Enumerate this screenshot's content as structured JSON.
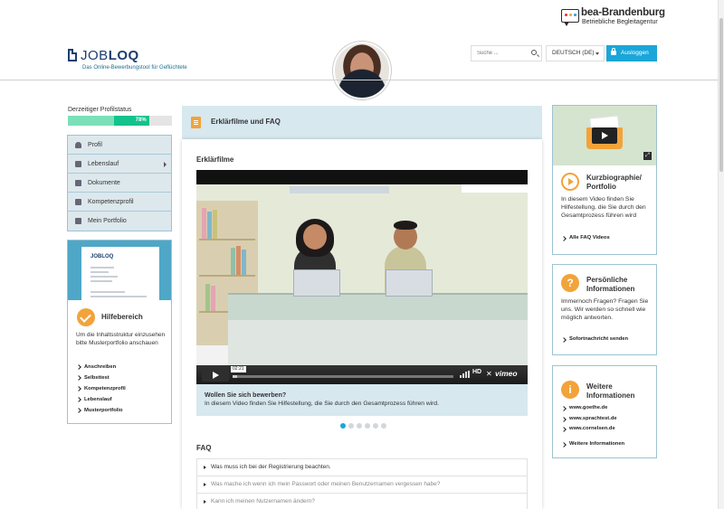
{
  "brand": {
    "partner_name": "bea-Brandenburg",
    "partner_subtitle": "Betriebliche Begleitagentur",
    "app_name_light": "JOB",
    "app_name_bold": "LOQ",
    "tagline": "Das Online-Bewerbungstool für Geflüchtete",
    "colors": {
      "navy": "#1c3e70",
      "accent": "#1aa6d9",
      "orange": "#f2a33a",
      "green": "#14c28b",
      "panel": "#d7e8ef"
    }
  },
  "header": {
    "search_placeholder": "Suche ...",
    "language": "DEUTSCH (DE)",
    "logout_label": "Ausloggen"
  },
  "profile": {
    "status_label": "Derzeitiger Profilstatus",
    "progress_percent": 78,
    "progress_text": "78%"
  },
  "sidebar": {
    "items": [
      {
        "label": "Profil",
        "icon": "person-icon"
      },
      {
        "label": "Lebenslauf",
        "icon": "cv-icon"
      },
      {
        "label": "Dokumente",
        "icon": "documents-icon"
      },
      {
        "label": "Kompetenzprofil",
        "icon": "folder-icon"
      },
      {
        "label": "Mein Portfolio",
        "icon": "portfolio-icon"
      }
    ]
  },
  "help": {
    "mini_logo": "JOBLOQ",
    "title": "Hilfebereich",
    "text": "Um die Inhaltsstruktur einzusehen bitte Musterportfolio anschauen",
    "links": [
      "Anschreiben",
      "Selbsttest",
      "Kompetenzprofil",
      "Lebenslauf",
      "Musterportfolio"
    ]
  },
  "main": {
    "title": "Erklärfilme und FAQ",
    "films_heading": "Erklärfilme",
    "video": {
      "time": "02:21",
      "progress": 0.02,
      "hd_label": "HD",
      "brand": "vimeo",
      "caption_title": "Wollen Sie sich bewerben?",
      "caption_text": "In diesem Video finden Sie Hilfestellung, die Sie durch den Gesamtprozess führen wird."
    },
    "carousel": {
      "count": 6,
      "active": 0
    },
    "faq_heading": "FAQ",
    "faq": [
      "Was muss ich bei der Registrierung beachten.",
      "Was mache ich wenn ich mein Passwort oder meinen Benutzernamen vergessen habe?",
      "Kann ich meinen Nutzernamen ändern?"
    ]
  },
  "right": {
    "bio": {
      "title": "Kurzbiographie/ Portfolio",
      "text": "In diesem Video finden Sie Hilfestellung, die Sie durch den Gesamtprozess führen wird",
      "link": "Alle FAQ Videos"
    },
    "personal": {
      "title": "Persönliche Informationen",
      "text": "Immernoch Fragen? Fragen Sie uns. Wir werden so schnell wie möglich antworten.",
      "link": "Sofortnachricht senden"
    },
    "more": {
      "title": "Weitere Informationen",
      "links": [
        "www.goethe.de",
        "www.sprachtest.de",
        "www.cornelsen.de"
      ],
      "footer_link": "Weitere Informationen"
    }
  }
}
